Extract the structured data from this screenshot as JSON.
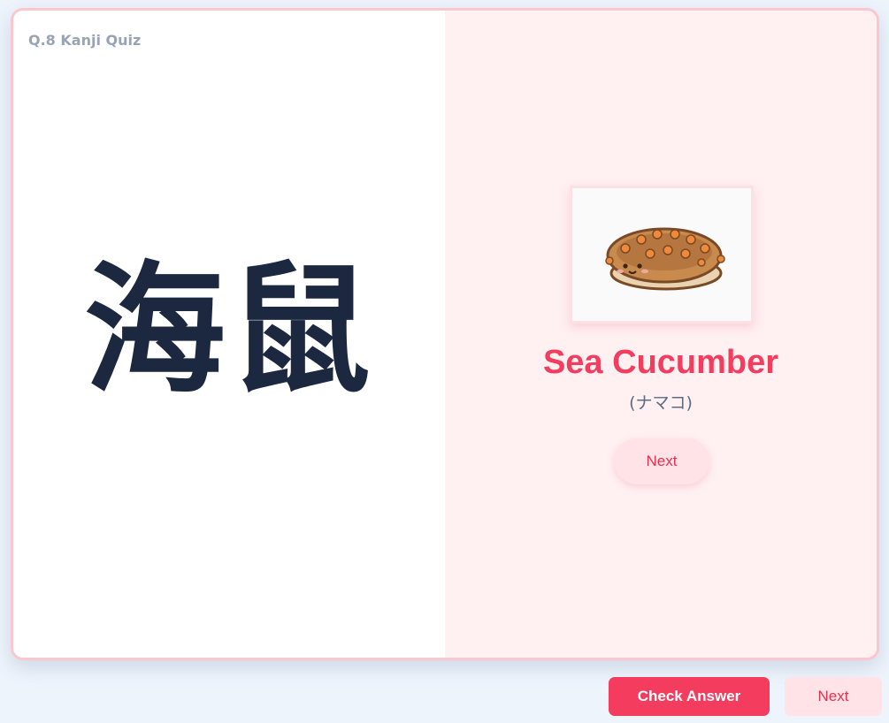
{
  "quiz": {
    "label": "Q.8 Kanji Quiz",
    "kanji": "海鼠"
  },
  "answer": {
    "word": "Sea Cucumber",
    "reading": "(ナマコ)",
    "image_icon": "sea-cucumber-illustration",
    "next_label": "Next"
  },
  "footer": {
    "check_label": "Check Answer",
    "next_label": "Next"
  },
  "colors": {
    "accent": "#f43c5e",
    "card_border": "#fcc6cf",
    "kanji_text": "#1c2740",
    "answer_bg": "#fff0f1"
  }
}
